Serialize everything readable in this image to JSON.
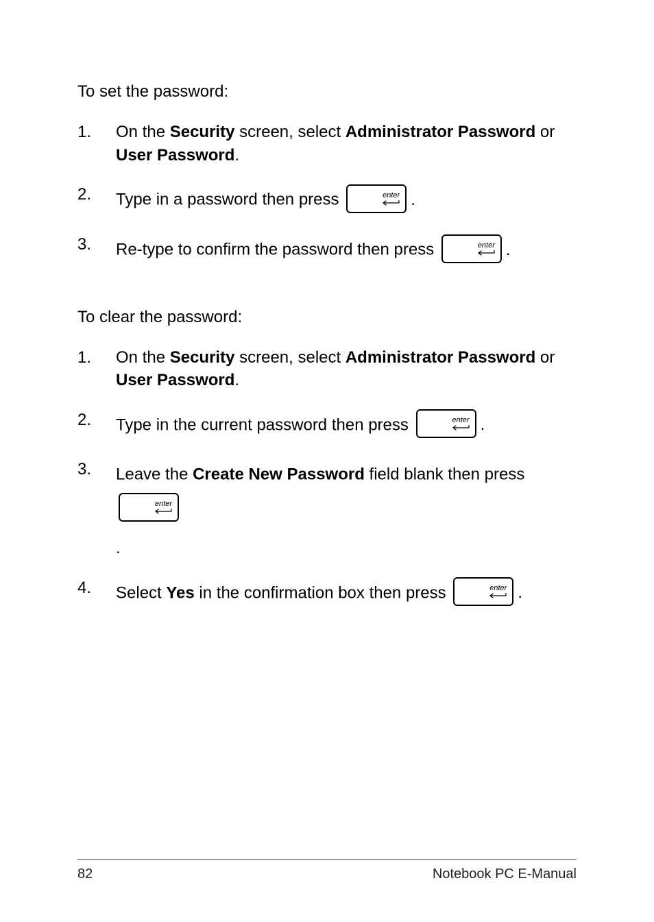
{
  "section1": {
    "intro": "To set the password:",
    "steps": [
      {
        "num": "1.",
        "pre": "On the ",
        "b1": "Security",
        "mid1": " screen, select ",
        "b2": "Administrator Password",
        "mid2": " or ",
        "b3": "User Password",
        "post": "."
      },
      {
        "num": "2.",
        "text": "Type in a password then press ",
        "key": "enter",
        "period": "."
      },
      {
        "num": "3.",
        "text": "Re-type to confirm the password then press ",
        "key": "enter",
        "period": "."
      }
    ]
  },
  "section2": {
    "intro": "To clear the password:",
    "steps": [
      {
        "num": "1.",
        "pre": "On the ",
        "b1": "Security",
        "mid1": " screen, select ",
        "b2": "Administrator Password",
        "mid2": " or ",
        "b3": "User Password",
        "post": "."
      },
      {
        "num": "2.",
        "text": "Type in the current password then press ",
        "key": "enter",
        "period": "."
      },
      {
        "num": "3.",
        "pre": "Leave the ",
        "b1": "Create New Password",
        "post": " field blank then press ",
        "key": "enter",
        "orphan": "."
      },
      {
        "num": "4.",
        "pre": "Select ",
        "b1": "Yes",
        "post": " in the confirmation box then press ",
        "key": "enter",
        "period": "."
      }
    ]
  },
  "footer": {
    "page": "82",
    "title": "Notebook PC E-Manual"
  },
  "key_label": "enter"
}
